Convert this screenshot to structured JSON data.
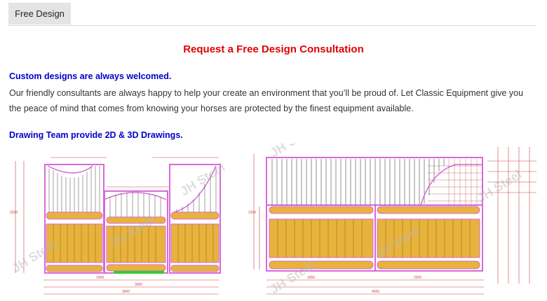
{
  "tabs": [
    {
      "label": "Free Design"
    }
  ],
  "heading": "Request a Free Design Consultation",
  "intro": {
    "highlight": "Custom designs are always welcomed.",
    "text": "Our friendly consultants are always happy to help your create an environment that you’ll be proud of. Let Classic Equipment give you the peace of mind that comes from knowing your horses are protected by the finest equipment available."
  },
  "drawing_section": {
    "heading": "Drawing Team provide 2D & 3D Drawings."
  },
  "watermark": "JH Steel",
  "colors": {
    "heading": "#e00000",
    "highlight": "#0000cc",
    "frame": "#d86ad8",
    "panel": "#e8b33c",
    "bars": "#444444"
  }
}
